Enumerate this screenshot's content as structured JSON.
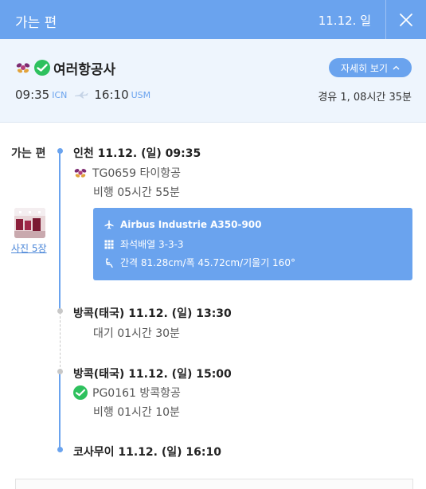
{
  "header": {
    "title": "가는 편",
    "date": "11.12. 일"
  },
  "summary": {
    "airline_name": "여러항공사",
    "detail_label": "자세히 보기",
    "departure_time": "09:35",
    "departure_code": "ICN",
    "arrival_time": "16:10",
    "arrival_code": "USM",
    "stops_duration": "경유 1, 08시간 35분"
  },
  "timeline": {
    "section_label": "가는 편",
    "photo_link": "사진 5장",
    "segments": [
      {
        "departure": "인천 11.12. (일) 09:35",
        "flight": "TG0659 타이항공",
        "duration": "비행 05시간 55분"
      },
      {
        "departure": "방콕(태국) 11.12. (일) 15:00",
        "flight": "PG0161 방콕항공",
        "duration": "비행 01시간 10분"
      }
    ],
    "layover": {
      "arrival": "방콕(태국) 11.12. (일) 13:30",
      "wait": "대기 01시간 30분"
    },
    "final_arrival": "코사무이 11.12. (일) 16:10",
    "aircraft_info": {
      "model": "Airbus Industrie A350-900",
      "seat_layout": "좌석배열 3-3-3",
      "seat_spacing": "간격 81.28cm/폭 45.72cm/기울기 160°"
    }
  },
  "colors": {
    "accent": "#6aa3ee",
    "summary_bg": "#eef5fd",
    "bangkok_airways_green": "#2ec15e"
  },
  "icons": [
    "close-icon",
    "thai-airways-logo",
    "bangkok-airways-logo",
    "chevron-up-icon",
    "plane-icon",
    "seat-grid-icon",
    "seat-recline-icon"
  ]
}
